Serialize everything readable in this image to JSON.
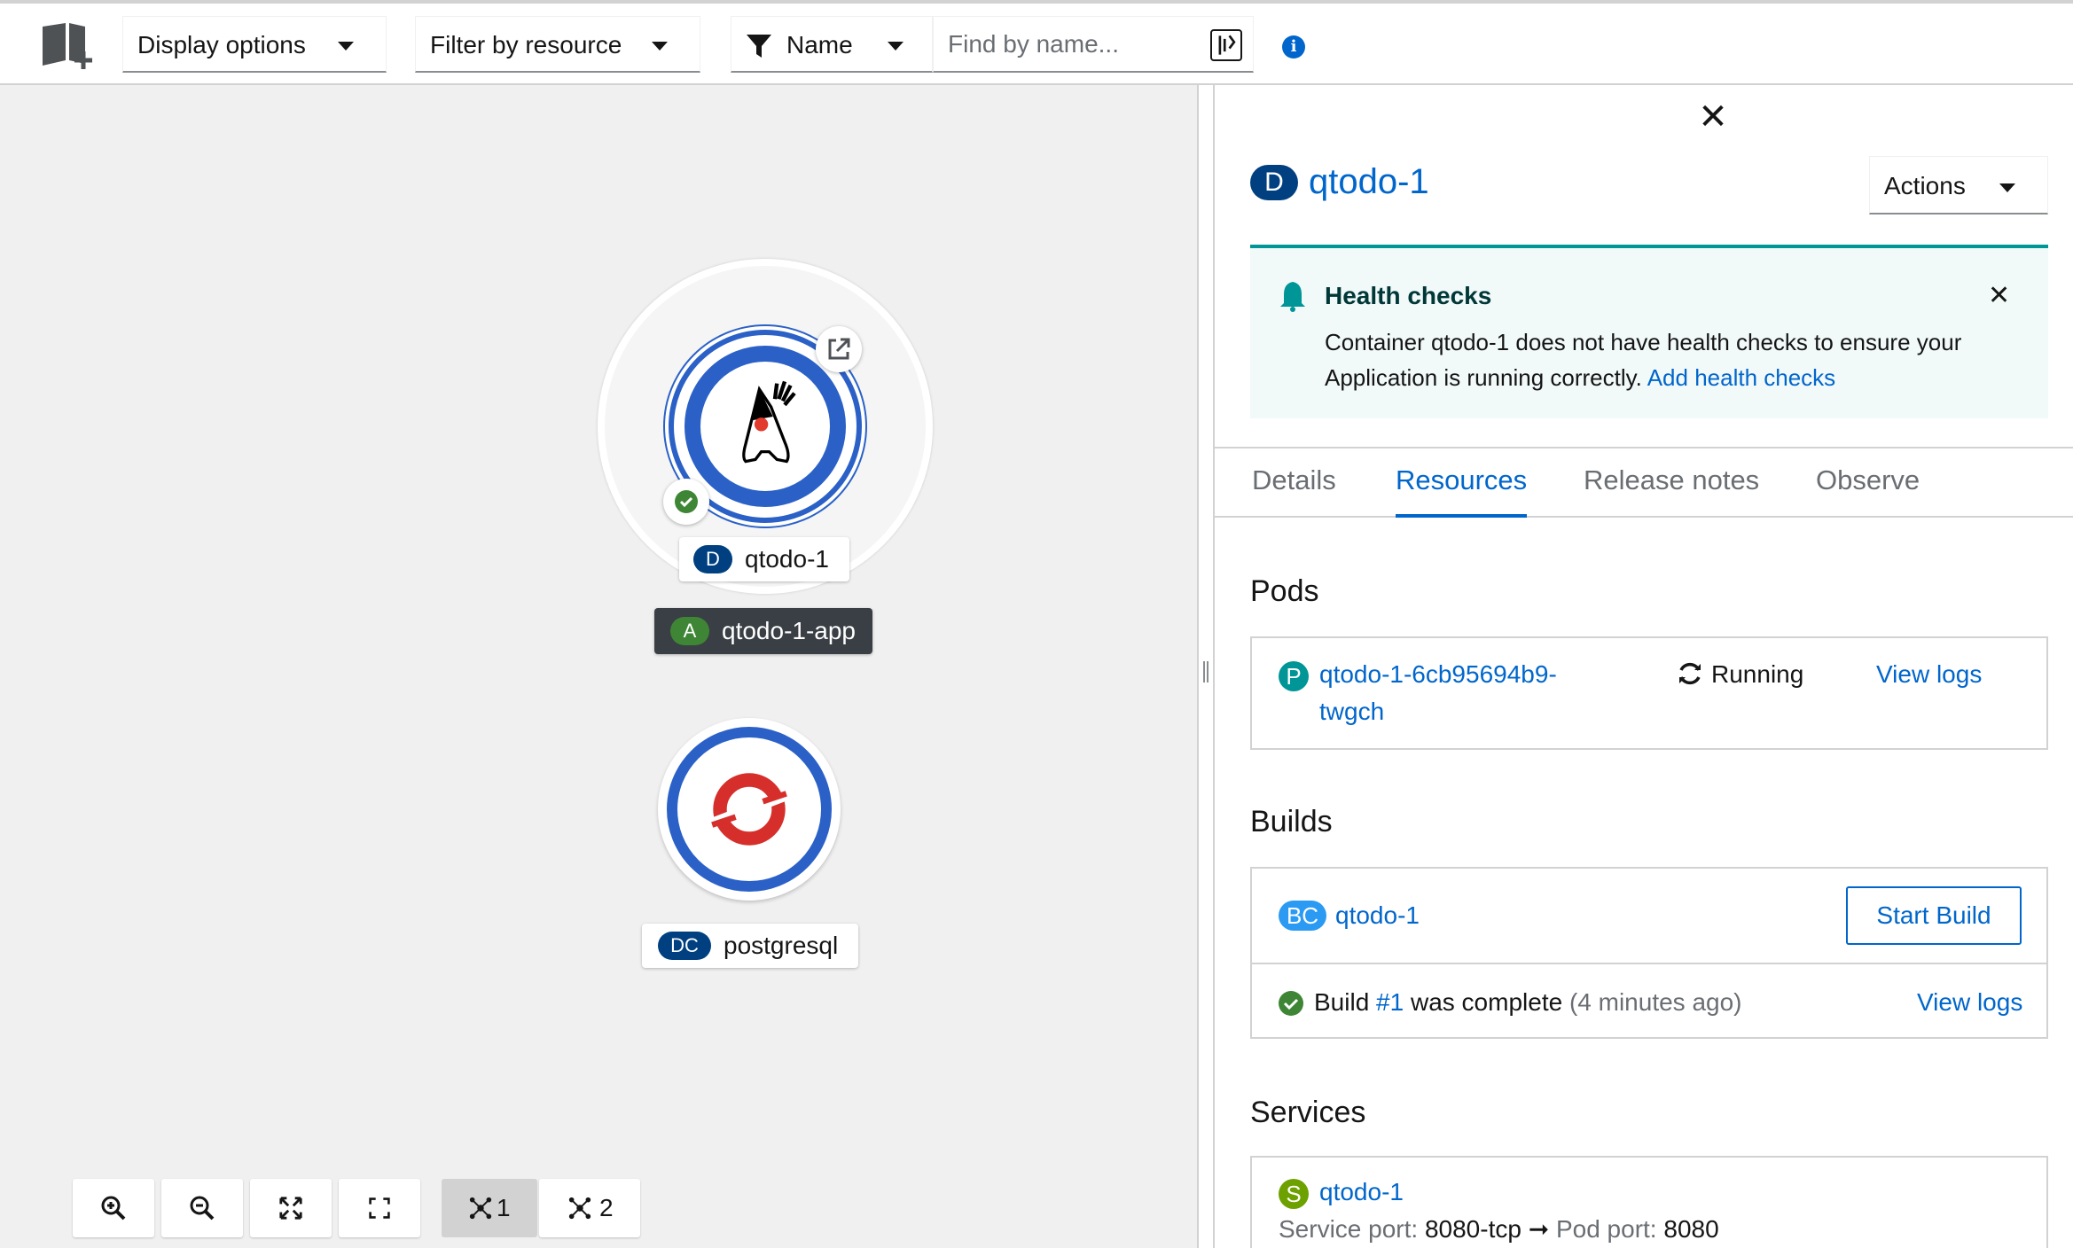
{
  "toolbar": {
    "display_options": "Display options",
    "filter_by_resource": "Filter by resource",
    "filter_type": "Name",
    "search_placeholder": "Find by name...",
    "info_glyph": "i"
  },
  "topology": {
    "application": {
      "badge": "A",
      "name": "qtodo-1-app"
    },
    "nodes": [
      {
        "badge": "D",
        "name": "qtodo-1",
        "icon": "java-duke-icon",
        "status": "ok"
      },
      {
        "badge": "DC",
        "name": "postgresql",
        "icon": "openshift-icon"
      }
    ],
    "controls": {
      "zoom_in_icon": "zoom-in-icon",
      "zoom_out_icon": "zoom-out-icon",
      "fit_icon": "fit-to-screen-icon",
      "reset_icon": "reset-view-icon",
      "layout1": "1",
      "layout2": "2"
    }
  },
  "panel": {
    "close": "✕",
    "badge": "D",
    "title": "qtodo-1",
    "actions_label": "Actions",
    "alert": {
      "title": "Health checks",
      "message": "Container qtodo-1 does not have health checks to ensure your Application is running correctly.",
      "link": "Add health checks",
      "close": "✕"
    },
    "tabs": [
      "Details",
      "Resources",
      "Release notes",
      "Observe"
    ],
    "active_tab": "Resources",
    "pods": {
      "heading": "Pods",
      "badge": "P",
      "name": "qtodo-1-6cb95694b9-twgch",
      "status": "Running",
      "logs": "View logs"
    },
    "builds": {
      "heading": "Builds",
      "badge": "BC",
      "name": "qtodo-1",
      "start": "Start Build",
      "build_prefix": "Build",
      "build_link": "#1",
      "build_status": "was complete",
      "build_time": "(4 minutes ago)",
      "logs": "View logs"
    },
    "services": {
      "heading": "Services",
      "badge": "S",
      "name": "qtodo-1",
      "service_port_label": "Service port:",
      "service_port": "8080-tcp",
      "arrow": "➞",
      "pod_port_label": "Pod port:",
      "pod_port": "8080"
    }
  },
  "colors": {
    "link": "#0066cc",
    "node_ring": "#2b61c7",
    "ok": "#3e8635",
    "alert_border": "#009596"
  }
}
